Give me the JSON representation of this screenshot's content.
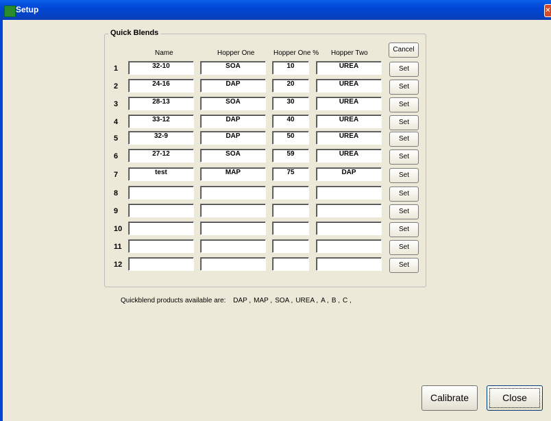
{
  "window": {
    "title": "Setup",
    "close_glyph": "✕"
  },
  "group": {
    "title": "Quick Blends"
  },
  "headers": {
    "name": "Name",
    "hopper_one": "Hopper One",
    "hopper_one_pct": "Hopper One %",
    "hopper_two": "Hopper Two"
  },
  "buttons": {
    "cancel": "Cancel",
    "set": "Set",
    "calibrate": "Calibrate",
    "close": "Close"
  },
  "rows": [
    {
      "num": "1",
      "name": "32-10",
      "h1": "SOA",
      "pct": "10",
      "h2": "UREA"
    },
    {
      "num": "2",
      "name": "24-16",
      "h1": "DAP",
      "pct": "20",
      "h2": "UREA"
    },
    {
      "num": "3",
      "name": "28-13",
      "h1": "SOA",
      "pct": "30",
      "h2": "UREA"
    },
    {
      "num": "4",
      "name": "33-12",
      "h1": "DAP",
      "pct": "40",
      "h2": "UREA"
    },
    {
      "num": "5",
      "name": "32-9",
      "h1": "DAP",
      "pct": "50",
      "h2": "UREA"
    },
    {
      "num": "6",
      "name": "27-12",
      "h1": "SOA",
      "pct": "59",
      "h2": "UREA"
    },
    {
      "num": "7",
      "name": "test",
      "h1": "MAP",
      "pct": "75",
      "h2": "DAP"
    },
    {
      "num": "8",
      "name": "",
      "h1": "",
      "pct": "",
      "h2": ""
    },
    {
      "num": "9",
      "name": "",
      "h1": "",
      "pct": "",
      "h2": ""
    },
    {
      "num": "10",
      "name": "",
      "h1": "",
      "pct": "",
      "h2": ""
    },
    {
      "num": "11",
      "name": "",
      "h1": "",
      "pct": "",
      "h2": ""
    },
    {
      "num": "12",
      "name": "",
      "h1": "",
      "pct": "",
      "h2": ""
    }
  ],
  "available": {
    "label": "Quickblend products available are:",
    "products": [
      "DAP ,",
      "MAP ,",
      "SOA ,",
      "UREA ,",
      "A ,",
      "B ,",
      "C ,"
    ]
  }
}
